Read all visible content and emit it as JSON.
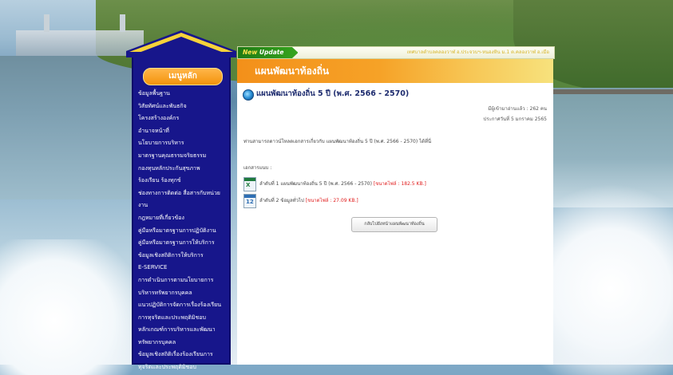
{
  "sidebar": {
    "header": "เมนูหลัก",
    "items": [
      "ข้อมูลพื้นฐาน",
      "วิสัยทัศน์และพันธกิจ",
      "โครงสร้างองค์กร",
      "อำนาจหน้าที่",
      "นโยบายการบริหาร",
      "มาตรฐานคุณธรรมจริยธรรม",
      "กองทุนหลักประกันสุขภาพ",
      "ร้องเรียน ร้องทุกข์",
      "ช่องทางการติดต่อ สื่อสารกับหน่วย",
      "งาน",
      "กฎหมายที่เกี่ยวข้อง",
      "คู่มือหรือมาตรฐานการปฏิบัติงาน",
      "คู่มือหรือมาตรฐานการให้บริการ",
      "ข้อมูลเชิงสถิติการให้บริการ",
      "E-SERVICE",
      "การดำเนินการตามนโยบายการ",
      "บริหารทรัพยากรบุคคล",
      "แนวปฏิบัติการจัดการเรื่องร้องเรียน",
      "การทุจริตและประพฤติมิชอบ",
      "หลักเกณฑ์การบริหารและพัฒนา",
      "ทรัพยากรบุคคล",
      "ข้อมูลเชิงสถิติเรื่องร้องเรียนการ",
      "ทุจริตและประพฤติมิชอบ"
    ]
  },
  "topbar": {
    "new_label": "New",
    "update_label": "Update",
    "marquee": "เทศบาลตำบลคลองวาฬ อ.ประจวบฯ-หนองหิน ม.1 ต.คลองวาฬ อ.เมือ"
  },
  "content": {
    "header": "แผนพัฒนาท้องถิ่น",
    "plan_title": "แผนพัฒนาท้องถิ่น 5 ปี (พ.ศ. 2566 - 2570)",
    "views": "มีผู้เข้ามาอ่านแล้ว : 262 คน",
    "announced": "ประกาศวันที่  5 มกราคม 2565",
    "description": "ท่านสามารถดาวน์โหลดเอกสารเกี่ยวกับ แผนพัฒนาท้องถิ่น 5 ปี (พ.ศ. 2566 - 2570) ได้ที่นี่",
    "docs_label": "เอกสารแนบ :",
    "docs": [
      {
        "text": "ลำดับที่ 1 แผนพัฒนาท้องถิ่น 5 ปี (พ.ศ. 2566 - 2570)",
        "size": "[ขนาดไฟล์ : 182.5 KB.]",
        "icon": "excel-file-icon"
      },
      {
        "text": "ลำดับที่ 2 ข้อมูลทั่วไป",
        "size": "[ขนาดไฟล์ : 27.09 KB.]",
        "icon": "calendar-file-icon"
      }
    ],
    "back_button": "กลับไปยังหน้าแผนพัฒนาท้องถิ่น"
  },
  "colors": {
    "sidebar_bg": "#17168b",
    "menu_header": "#f3930c",
    "header_orange": "#f3901a",
    "file_size_red": "#e01b1b",
    "title_blue": "#1d2b6e"
  }
}
